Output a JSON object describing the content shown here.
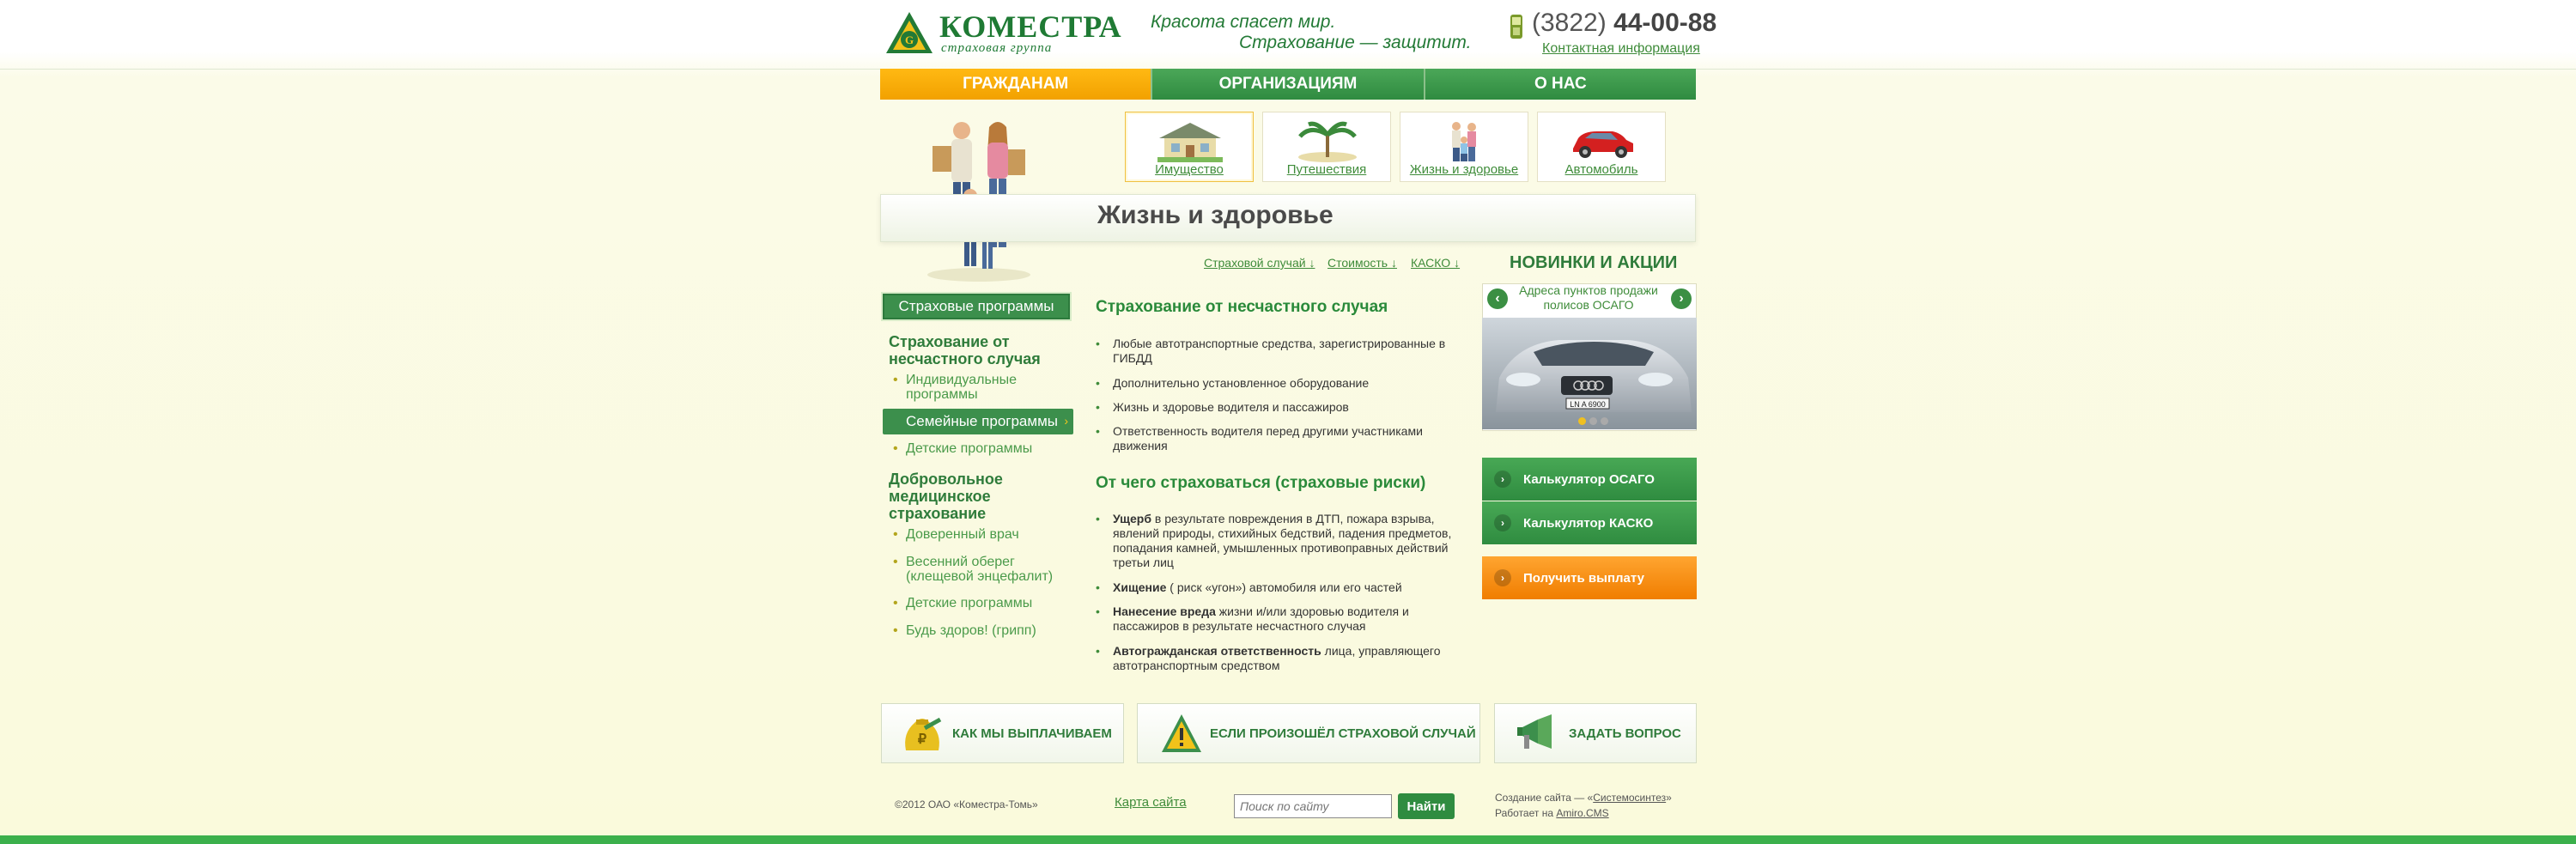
{
  "header": {
    "logo_name": "КОМЕСТРА",
    "logo_sub": "страховая группа",
    "slogan_line1": "Красота спасет мир.",
    "slogan_line2": "Страхование — защитит.",
    "phone_code": "(3822)",
    "phone_number": "44-00-88",
    "contact_link": "Контактная информация"
  },
  "nav": {
    "items": [
      {
        "label": "ГРАЖДАНАМ"
      },
      {
        "label": "ОРГАНИЗАЦИЯМ"
      },
      {
        "label": "О НАС"
      }
    ]
  },
  "categories": [
    {
      "label": "Имущество",
      "icon": "house-icon"
    },
    {
      "label": "Путешествия",
      "icon": "palm-icon"
    },
    {
      "label": "Жизнь и здоровье",
      "icon": "family-icon"
    },
    {
      "label": "Автомобиль",
      "icon": "car-icon"
    }
  ],
  "page_title": "Жизнь и здоровье",
  "anchors": [
    {
      "label": "Страховой случай ↓"
    },
    {
      "label": "Стоимость ↓"
    },
    {
      "label": "КАСКО ↓"
    }
  ],
  "sidebar": {
    "section_label": "Страховые программы",
    "group1": "Страхование от несчастного случая",
    "group1_items": [
      "Индивидуальные программы",
      "Семейные программы",
      "Детские программы"
    ],
    "group2": "Добровольное медицинское страхование",
    "group2_items": [
      "Доверенный врач",
      "Весенний оберег (клещевой энцефалит)",
      "Детские программы",
      "Будь здоров! (грипп)"
    ]
  },
  "content": {
    "h1": "Страхование от несчастного случая",
    "list1": [
      "Любые автотранспортные средства, зарегистрированные в ГИБДД",
      "Дополнительно установленное оборудование",
      "Жизнь и здоровье водителя и пассажиров",
      "Ответственность водителя перед другими участниками движения"
    ],
    "h2": "От чего страховаться (страховые риски)",
    "list2": [
      {
        "bold": "Ущерб",
        "text": " в результате повреждения в ДТП, пожара взрыва, явлений природы, стихийных бедствий, падения предметов, попадания камней, умышленных противоправных действий третьи лиц"
      },
      {
        "bold": "Хищение",
        "text": " ( риск «угон») автомобиля или его частей"
      },
      {
        "bold": "Нанесение вреда",
        "text": " жизни и/или здоровью водителя и пассажиров в результате несчастного случая"
      },
      {
        "bold": "Автогражданская ответственность",
        "text": " лица, управляющего автотранспортным средством"
      }
    ]
  },
  "right": {
    "news_title": "НОВИНКИ И АКЦИИ",
    "slide_caption": "Адреса пунктов продажи полисов ОСАГО",
    "slide_count": 3,
    "slide_current": 1,
    "btn_osago": "Калькулятор ОСАГО",
    "btn_kasko": "Калькулятор КАСКО",
    "btn_payout": "Получить выплату",
    "plate": "LN A 6900"
  },
  "bottom": {
    "box1": "КАК МЫ ВЫПЛАЧИВАЕМ",
    "box2": "ЕСЛИ ПРОИЗОШЁЛ СТРАХОВОЙ СЛУЧАЙ",
    "box3": "ЗАДАТЬ ВОПРОС"
  },
  "footer": {
    "copyright": "©2012 ОАО «Коместра-Томь»",
    "sitemap": "Карта сайта",
    "search_placeholder": "Поиск по сайту",
    "search_button": "Найти",
    "credit1_prefix": "Создание сайта — «",
    "credit1_link": "Системосинтез",
    "credit1_suffix": "»",
    "credit2_prefix": "Работает на ",
    "credit2_link": "Amiro.CMS"
  },
  "colors": {
    "brand_green": "#2f8c40",
    "accent_orange": "#f2a100",
    "link_green": "#3f8c3a"
  }
}
